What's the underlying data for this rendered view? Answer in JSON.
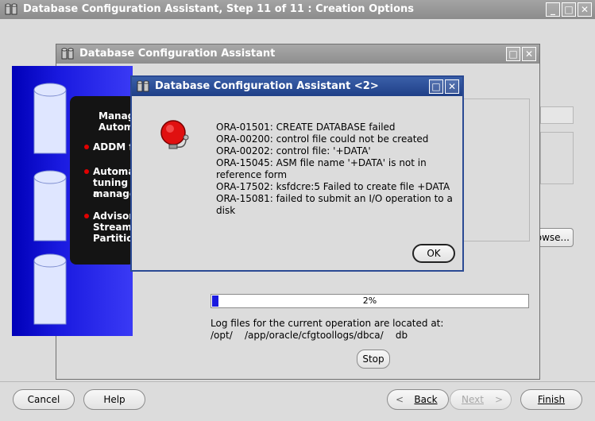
{
  "main_window": {
    "title": "Database Configuration Assistant, Step 11 of 11 : Creation Options",
    "buttons": {
      "cancel": "Cancel",
      "help": "Help",
      "back": "Back",
      "next": "Next",
      "finish": "Finish"
    },
    "browse_label": "owse..."
  },
  "progress_window": {
    "title": "Database Configuration Assistant",
    "banner": {
      "heading_line1": "Manag",
      "heading_line2": "Autom",
      "bullets": [
        [
          "ADDM f"
        ],
        [
          "Automa",
          "tuning a",
          "manage"
        ],
        [
          "Advisor",
          "Streams",
          "Partition"
        ]
      ]
    },
    "progress": {
      "percent_label": "2%",
      "value": 0.02
    },
    "log_line1": "Log files for the current operation are located at:",
    "log_line2": "/opt/    /app/oracle/cfgtoollogs/dbca/    db",
    "stop_button": "Stop"
  },
  "error_dialog": {
    "title": "Database Configuration Assistant <2>",
    "icon": "alarm-bell-icon",
    "lines": [
      "ORA-01501: CREATE DATABASE failed",
      "ORA-00200: control file could not be created",
      "ORA-00202: control file: '+DATA'",
      "ORA-15045: ASM file name '+DATA' is not in",
      "reference form",
      "ORA-17502: ksfdcre:5 Failed to create file +DATA",
      "ORA-15081: failed to submit an I/O operation to a",
      "disk"
    ],
    "ok_button": "OK"
  },
  "colors": {
    "active_titlebar": "#1f3f87",
    "inactive_titlebar": "#808080",
    "progress_fill": "#1a1adf",
    "bullet": "#e00000"
  }
}
